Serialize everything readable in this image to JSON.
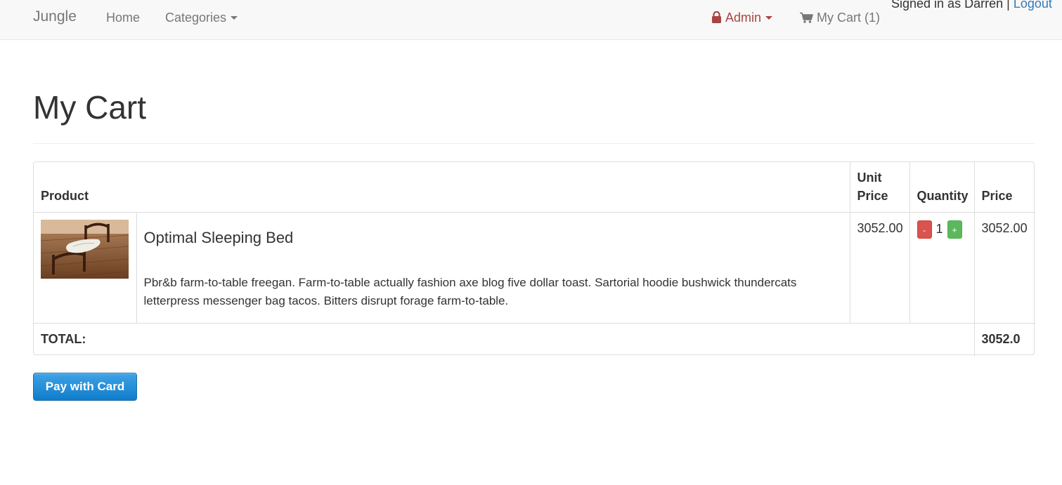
{
  "navbar": {
    "brand": "Jungle",
    "home_label": "Home",
    "categories_label": "Categories",
    "admin_label": "Admin",
    "cart_label": "My Cart (1)",
    "signed_in_text": "Signed in as Darren",
    "separator": "|",
    "logout_label": "Logout",
    "icons": {
      "admin": "lock-icon",
      "cart": "shopping-cart-icon"
    },
    "colors": {
      "admin": "#a94442",
      "logout": "#337ab7"
    }
  },
  "page": {
    "title": "My Cart"
  },
  "cart": {
    "columns": {
      "product": "Product",
      "unit_price": "Unit Price",
      "quantity": "Quantity",
      "price": "Price"
    },
    "items": [
      {
        "name": "Optimal Sleeping Bed",
        "description": "Pbr&b farm-to-table freegan. Farm-to-table actually fashion axe blog five dollar toast. Sartorial hoodie bushwick thundercats letterpress messenger bag tacos. Bitters disrupt forage farm-to-table.",
        "unit_price": "3052.00",
        "quantity": "1",
        "price": "3052.00",
        "decrement_label": "-",
        "increment_label": "+"
      }
    ],
    "total_label": "TOTAL:",
    "total_value": "3052.0"
  },
  "actions": {
    "pay_label": "Pay with Card",
    "pay_color": "#1a8ad8"
  }
}
